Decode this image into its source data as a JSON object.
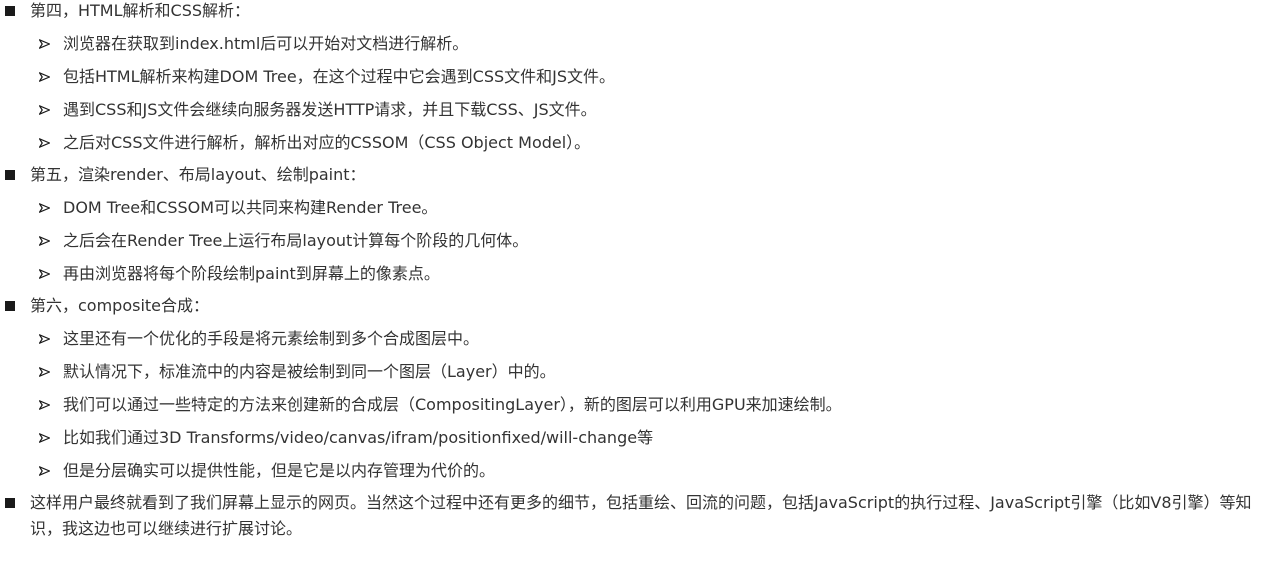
{
  "sections": [
    {
      "heading": "第四，HTML解析和CSS解析：",
      "items": [
        "浏览器在获取到index.html后可以开始对文档进行解析。",
        "包括HTML解析来构建DOM Tree，在这个过程中它会遇到CSS文件和JS文件。",
        "遇到CSS和JS文件会继续向服务器发送HTTP请求，并且下载CSS、JS文件。",
        "之后对CSS文件进行解析，解析出对应的CSSOM（CSS Object Model）。"
      ]
    },
    {
      "heading": "第五，渲染render、布局layout、绘制paint：",
      "items": [
        "DOM Tree和CSSOM可以共同来构建Render Tree。",
        "之后会在Render Tree上运行布局layout计算每个阶段的几何体。",
        "再由浏览器将每个阶段绘制paint到屏幕上的像素点。"
      ]
    },
    {
      "heading": "第六，composite合成：",
      "items": [
        "这里还有一个优化的手段是将元素绘制到多个合成图层中。",
        "默认情况下，标准流中的内容是被绘制到同一个图层（Layer）中的。",
        "我们可以通过一些特定的方法来创建新的合成层（CompositingLayer），新的图层可以利用GPU来加速绘制。",
        "比如我们通过3D Transforms/video/canvas/ifram/positionfixed/will-change等",
        "但是分层确实可以提供性能，但是它是以内存管理为代价的。"
      ]
    }
  ],
  "closing": "这样用户最终就看到了我们屏幕上显示的网页。当然这个过程中还有更多的细节，包括重绘、回流的问题，包括JavaScript的执行过程、JavaScript引擎（比如V8引擎）等知识，我这边也可以继续进行扩展讨论。",
  "icons": {
    "bullet": "square-bullet-icon",
    "sub_bullet": "arrowhead-bullet-icon"
  }
}
